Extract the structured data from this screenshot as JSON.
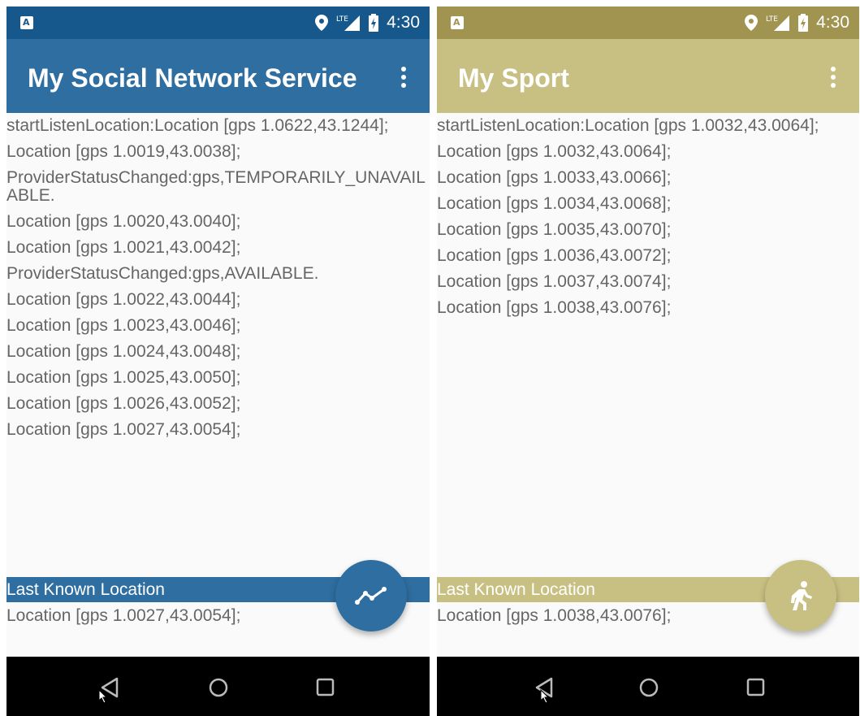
{
  "status_bar": {
    "time": "4:30",
    "network_label": "LTE",
    "sim_glyph": "A"
  },
  "phones": [
    {
      "title": "My Social Network Service",
      "colors": {
        "status": "#16578c",
        "appbar": "#2e6ea0",
        "fab": "#2e6ea0"
      },
      "log_lines": [
        "startListenLocation:Location [gps 1.0622,43.1244];",
        "Location [gps 1.0019,43.0038];",
        "ProviderStatusChanged:gps,TEMPORARILY_UNAVAILABLE.",
        "Location [gps 1.0020,43.0040];",
        "Location [gps 1.0021,43.0042];",
        "ProviderStatusChanged:gps,AVAILABLE.",
        "Location [gps 1.0022,43.0044];",
        "Location [gps 1.0023,43.0046];",
        "Location [gps 1.0024,43.0048];",
        "Location [gps 1.0025,43.0050];",
        "Location [gps 1.0026,43.0052];",
        "Location [gps 1.0027,43.0054];"
      ],
      "last_known_label": "Last Known Location",
      "last_known_value": "Location [gps 1.0027,43.0054];",
      "fab_icon": "trending-line-icon"
    },
    {
      "title": "My Sport",
      "colors": {
        "status": "#a09450",
        "appbar": "#c8c082",
        "fab": "#c8c082"
      },
      "log_lines": [
        "startListenLocation:Location [gps 1.0032,43.0064];",
        "Location [gps 1.0032,43.0064];",
        "Location [gps 1.0033,43.0066];",
        "Location [gps 1.0034,43.0068];",
        "Location [gps 1.0035,43.0070];",
        "Location [gps 1.0036,43.0072];",
        "Location [gps 1.0037,43.0074];",
        "Location [gps 1.0038,43.0076];"
      ],
      "last_known_label": "Last Known Location",
      "last_known_value": "Location [gps 1.0038,43.0076];",
      "fab_icon": "running-person-icon"
    }
  ]
}
